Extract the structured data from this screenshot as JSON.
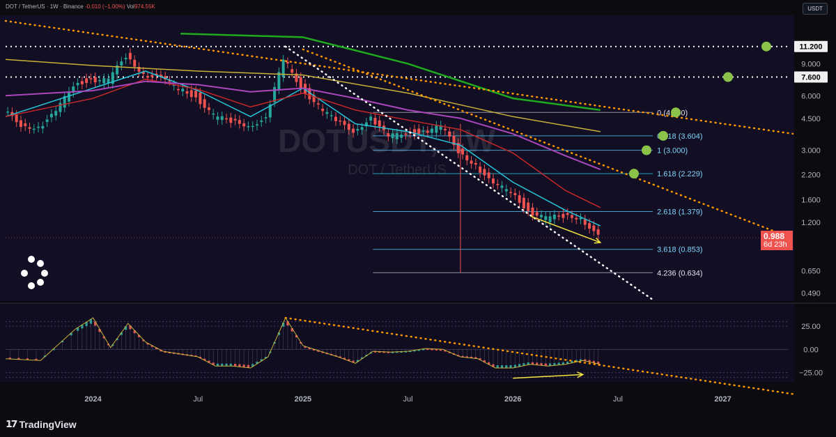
{
  "header": {
    "symbol": "DOT / TetherUS · 1W · Binance",
    "change": "-0.010 (−1.00%)",
    "volume_label": "Vol",
    "volume": "974.55K"
  },
  "currency_button": "USDT",
  "watermark": {
    "symbol": "DOTUSDT, 1W",
    "name": "DOT / TetherUS"
  },
  "footer": {
    "brand": "TradingView"
  },
  "current_price": {
    "value": "0.988",
    "countdown": "6d 23h"
  },
  "colors": {
    "background": "#0b0b10",
    "plot_bg": "#13112a",
    "up": "#26a69a",
    "down": "#ef5350",
    "ma_cyan": "#26c6da",
    "ma_red": "#c62828",
    "ma_magenta": "#ab47bc",
    "ma_yellow": "#c9b23a",
    "ma_green": "#1faa1f",
    "trend_orange": "#ff9800",
    "arrow_yellow": "#f5e642",
    "target_dot": "#8bc34a"
  },
  "chart_data": [
    {
      "type": "line",
      "title": "DOT / TetherUS, 1W",
      "y_scale": "log",
      "ylim": [
        0.45,
        15.5
      ],
      "y_ticks": [
        "11.200",
        "9.000",
        "7.600",
        "6.000",
        "4.500",
        "3.000",
        "2.200",
        "1.600",
        "1.200",
        "0.988",
        "0.650",
        "0.490"
      ],
      "x_ticks": [
        "2024",
        "Jul",
        "2025",
        "Jul",
        "2026",
        "Jul",
        "2027"
      ],
      "x_range": [
        "2023-08",
        "2027-05"
      ],
      "horizontal_levels": [
        11.2,
        7.6
      ],
      "highlighted_price_labels": [
        "11.200",
        "7.600"
      ],
      "fibonacci": {
        "levels": [
          {
            "label": "0 (4.850)",
            "value": 4.85
          },
          {
            "label": "0.618 (3.604)",
            "value": 3.604
          },
          {
            "label": "1 (3.000)",
            "value": 3.0
          },
          {
            "label": "1.618 (2.229)",
            "value": 2.229
          },
          {
            "label": "2.618 (1.379)",
            "value": 1.379
          },
          {
            "label": "3.618 (0.853)",
            "value": 0.853
          },
          {
            "label": "4.236 (0.634)",
            "value": 0.634
          }
        ]
      },
      "target_markers": [
        11.2,
        7.6,
        4.85,
        3.604,
        3.0,
        2.229
      ],
      "price_series": {
        "name": "DOTUSDT",
        "points": [
          [
            "2023-08",
            4.9
          ],
          [
            "2023-09",
            4.2
          ],
          [
            "2023-10",
            4.0
          ],
          [
            "2023-11",
            4.8
          ],
          [
            "2023-12",
            7.0
          ],
          [
            "2024-01",
            7.4
          ],
          [
            "2024-02",
            7.2
          ],
          [
            "2024-03",
            10.0
          ],
          [
            "2024-04",
            8.0
          ],
          [
            "2024-05",
            7.4
          ],
          [
            "2024-06",
            6.6
          ],
          [
            "2024-07",
            6.0
          ],
          [
            "2024-08",
            4.6
          ],
          [
            "2024-09",
            4.3
          ],
          [
            "2024-10",
            4.2
          ],
          [
            "2024-11",
            4.4
          ],
          [
            "2024-12",
            9.5
          ],
          [
            "2025-01",
            6.8
          ],
          [
            "2025-02",
            5.2
          ],
          [
            "2025-03",
            4.3
          ],
          [
            "2025-04",
            3.9
          ],
          [
            "2025-05",
            4.5
          ],
          [
            "2025-06",
            3.5
          ],
          [
            "2025-07",
            3.8
          ],
          [
            "2025-08",
            3.8
          ],
          [
            "2025-09",
            4.0
          ],
          [
            "2025-10",
            3.0
          ],
          [
            "2025-11",
            2.5
          ],
          [
            "2025-12",
            1.9
          ],
          [
            "2026-01",
            1.8
          ],
          [
            "2026-02",
            1.4
          ],
          [
            "2026-03",
            1.25
          ],
          [
            "2026-04",
            1.3
          ],
          [
            "2026-05",
            1.3
          ],
          [
            "2026-06",
            0.988
          ]
        ]
      },
      "moving_averages": [
        {
          "points": [
            [
              "2023-08",
              4.6
            ],
            [
              "2024-01",
              6.6
            ],
            [
              "2024-04",
              8.2
            ],
            [
              "2024-07",
              6.4
            ],
            [
              "2024-10",
              4.6
            ],
            [
              "2025-01",
              6.6
            ],
            [
              "2025-04",
              4.2
            ],
            [
              "2025-07",
              3.8
            ],
            [
              "2025-10",
              3.2
            ],
            [
              "2026-01",
              2.0
            ],
            [
              "2026-04",
              1.4
            ],
            [
              "2026-06",
              1.15
            ]
          ]
        },
        {
          "points": [
            [
              "2023-08",
              4.6
            ],
            [
              "2024-01",
              5.8
            ],
            [
              "2024-04",
              7.4
            ],
            [
              "2024-07",
              6.5
            ],
            [
              "2024-10",
              5.2
            ],
            [
              "2025-01",
              6.2
            ],
            [
              "2025-04",
              5.0
            ],
            [
              "2025-07",
              4.4
            ],
            [
              "2025-10",
              3.9
            ],
            [
              "2026-01",
              2.9
            ],
            [
              "2026-04",
              1.8
            ],
            [
              "2026-06",
              1.45
            ]
          ]
        },
        {
          "points": [
            [
              "2023-08",
              6.0
            ],
            [
              "2024-01",
              6.4
            ],
            [
              "2024-04",
              7.2
            ],
            [
              "2024-07",
              6.9
            ],
            [
              "2024-10",
              6.3
            ],
            [
              "2025-01",
              6.6
            ],
            [
              "2025-04",
              5.8
            ],
            [
              "2025-07",
              5.0
            ],
            [
              "2025-10",
              4.5
            ],
            [
              "2026-01",
              3.7
            ],
            [
              "2026-04",
              2.8
            ],
            [
              "2026-06",
              2.35
            ]
          ]
        },
        {
          "points": [
            [
              "2023-08",
              9.5
            ],
            [
              "2024-01",
              8.8
            ],
            [
              "2024-07",
              8.2
            ],
            [
              "2025-01",
              7.8
            ],
            [
              "2025-07",
              6.2
            ],
            [
              "2026-01",
              4.6
            ],
            [
              "2026-06",
              3.8
            ]
          ]
        },
        {
          "points": [
            [
              "2024-06",
              13.2
            ],
            [
              "2025-01",
              12.6
            ],
            [
              "2025-07",
              9.0
            ],
            [
              "2026-01",
              5.8
            ],
            [
              "2026-06",
              5.0
            ]
          ]
        }
      ],
      "trendlines": [
        {
          "style": "dotted",
          "points": [
            [
              "2023-08",
              15.5
            ],
            [
              "2027-05",
              3.7
            ]
          ]
        },
        {
          "style": "dotted",
          "points": [
            [
              "2025-01",
              10.8
            ],
            [
              "2027-05",
              0.98
            ]
          ]
        },
        {
          "style": "dotted",
          "points": [
            [
              "2024-12",
              11.2
            ],
            [
              "2026-09",
              0.45
            ]
          ]
        }
      ],
      "annotations": [
        {
          "type": "arrow",
          "from": [
            "2026-02",
            1.3
          ],
          "to": [
            "2026-06",
            0.93
          ]
        }
      ]
    },
    {
      "type": "bar",
      "title": "Oscillator",
      "ylim": [
        -35,
        40
      ],
      "y_ticks": [
        "25.00",
        "0.00",
        "−25.00"
      ],
      "bands": [
        30,
        25,
        -25,
        -30
      ],
      "series": [
        {
          "points": [
            [
              "2023-08",
              -10
            ],
            [
              "2023-10",
              -12
            ],
            [
              "2023-12",
              22
            ],
            [
              "2024-01",
              34
            ],
            [
              "2024-02",
              2
            ],
            [
              "2024-03",
              28
            ],
            [
              "2024-04",
              8
            ],
            [
              "2024-05",
              -2
            ],
            [
              "2024-06",
              -5
            ],
            [
              "2024-07",
              -8
            ],
            [
              "2024-08",
              -18
            ],
            [
              "2024-09",
              -18
            ],
            [
              "2024-10",
              -20
            ],
            [
              "2024-11",
              -8
            ],
            [
              "2024-12",
              34
            ],
            [
              "2025-01",
              4
            ],
            [
              "2025-02",
              -2
            ],
            [
              "2025-03",
              -8
            ],
            [
              "2025-04",
              -15
            ],
            [
              "2025-05",
              -2
            ],
            [
              "2025-06",
              -3
            ],
            [
              "2025-07",
              -2
            ],
            [
              "2025-08",
              1
            ],
            [
              "2025-09",
              0
            ],
            [
              "2025-10",
              -8
            ],
            [
              "2025-11",
              -10
            ],
            [
              "2025-12",
              -20
            ],
            [
              "2026-01",
              -20
            ],
            [
              "2026-02",
              -16
            ],
            [
              "2026-03",
              -18
            ],
            [
              "2026-04",
              -16
            ],
            [
              "2026-05",
              -12
            ],
            [
              "2026-06",
              -16
            ]
          ]
        }
      ],
      "trendlines": [
        {
          "style": "dotted",
          "points": [
            [
              "2024-12",
              34
            ],
            [
              "2027-05",
              -48
            ]
          ]
        }
      ],
      "annotations": [
        {
          "type": "arrow",
          "from": [
            "2026-01",
            -31
          ],
          "to": [
            "2026-05",
            -27
          ]
        }
      ]
    }
  ]
}
